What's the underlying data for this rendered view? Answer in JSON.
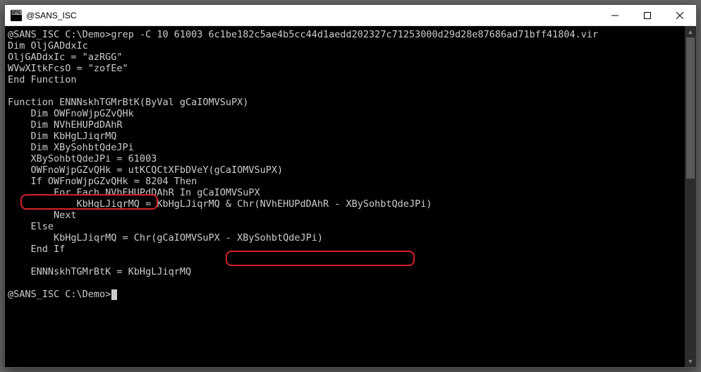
{
  "window": {
    "title": "@SANS_ISC"
  },
  "terminal": {
    "prompt1": "@SANS_ISC C:\\Demo>",
    "command": "grep -C 10 61003 6c1be182c5ae4b5cc44d1aedd202327c71253000d29d28e87686ad71bff41804.vir",
    "lines": [
      "Dim OljGADdxIc",
      "OljGADdxIc = \"azRGG\"",
      "WVwXItkFcsO = \"zofEe\"",
      "End Function",
      "",
      "Function ENNNskhTGMrBtK(ByVal gCaIOMVSuPX)",
      "    Dim OWFnoWjpGZvQHk",
      "    Dim NVhEHUPdDAhR",
      "    Dim KbHgLJiqrMQ",
      "    Dim XBySohbtQdeJPi",
      "    XBySohbtQdeJPi = 61003",
      "    OWFnoWjpGZvQHk = utKCQCtXFbDVeY(gCaIOMVSuPX)",
      "    If OWFnoWjpGZvQHk = 8204 Then",
      "        For Each NVhEHUPdDAhR In gCaIOMVSuPX",
      "            KbHgLJiqrMQ = KbHgLJiqrMQ & Chr(NVhEHUPdDAhR - XBySohbtQdeJPi)",
      "        Next",
      "    Else",
      "        KbHgLJiqrMQ = Chr(gCaIOMVSuPX - XBySohbtQdeJPi)",
      "    End If",
      "",
      "    ENNNskhTGMrBtK = KbHgLJiqrMQ",
      ""
    ],
    "prompt2": "@SANS_ISC C:\\Demo>"
  },
  "annotations": {
    "box1_target": "XBySohbtQdeJPi = 61003",
    "box2_target": "Chr(NVhEHUPdDAhR - XBySohbtQdeJPi)"
  }
}
